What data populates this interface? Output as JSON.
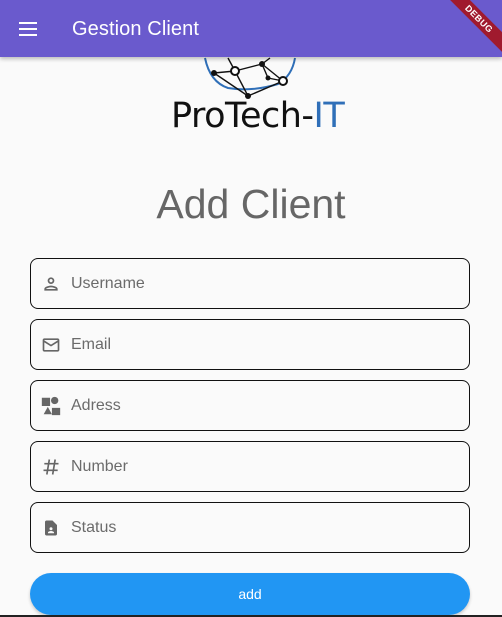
{
  "appbar": {
    "title": "Gestion Client",
    "menu_icon": "menu-icon",
    "color": "#6a5acd"
  },
  "debug_banner": "DEBUG",
  "logo": {
    "text_main": "ProTech-",
    "text_accent": "IT"
  },
  "heading": "Add Client",
  "fields": [
    {
      "name": "username",
      "placeholder": "Username",
      "icon": "person-icon"
    },
    {
      "name": "email",
      "placeholder": "Email",
      "icon": "mail-icon"
    },
    {
      "name": "adress",
      "placeholder": "Adress",
      "icon": "category-icon"
    },
    {
      "name": "number",
      "placeholder": "Number",
      "icon": "hash-icon"
    },
    {
      "name": "status",
      "placeholder": "Status",
      "icon": "badge-icon"
    }
  ],
  "button": {
    "label": "add",
    "color": "#2196f3"
  }
}
